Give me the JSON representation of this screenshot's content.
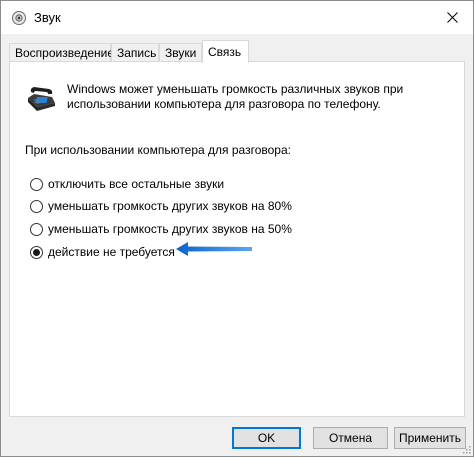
{
  "window": {
    "title": "Звук"
  },
  "tabs": [
    {
      "label": "Воспроизведение",
      "active": false
    },
    {
      "label": "Запись",
      "active": false
    },
    {
      "label": "Звуки",
      "active": false
    },
    {
      "label": "Связь",
      "active": true
    }
  ],
  "panel": {
    "description": "Windows может уменьшать громкость различных звуков при использовании компьютера для разговора по телефону.",
    "when_label": "При использовании компьютера для разговора:",
    "options": [
      {
        "label": "отключить все остальные звуки",
        "checked": false
      },
      {
        "label": "уменьшать громкость других звуков на 80%",
        "checked": false
      },
      {
        "label": "уменьшать громкость других звуков на 50%",
        "checked": false
      },
      {
        "label": "действие не требуется",
        "checked": true
      }
    ]
  },
  "buttons": {
    "ok": "OK",
    "cancel": "Отмена",
    "apply": "Применить"
  },
  "colors": {
    "accent": "#0078d7",
    "arrow": "#1a73d9"
  },
  "icons": {
    "app": "speaker-icon",
    "close": "close-icon",
    "phone": "telephone-icon",
    "annotation": "arrow-left-icon"
  }
}
